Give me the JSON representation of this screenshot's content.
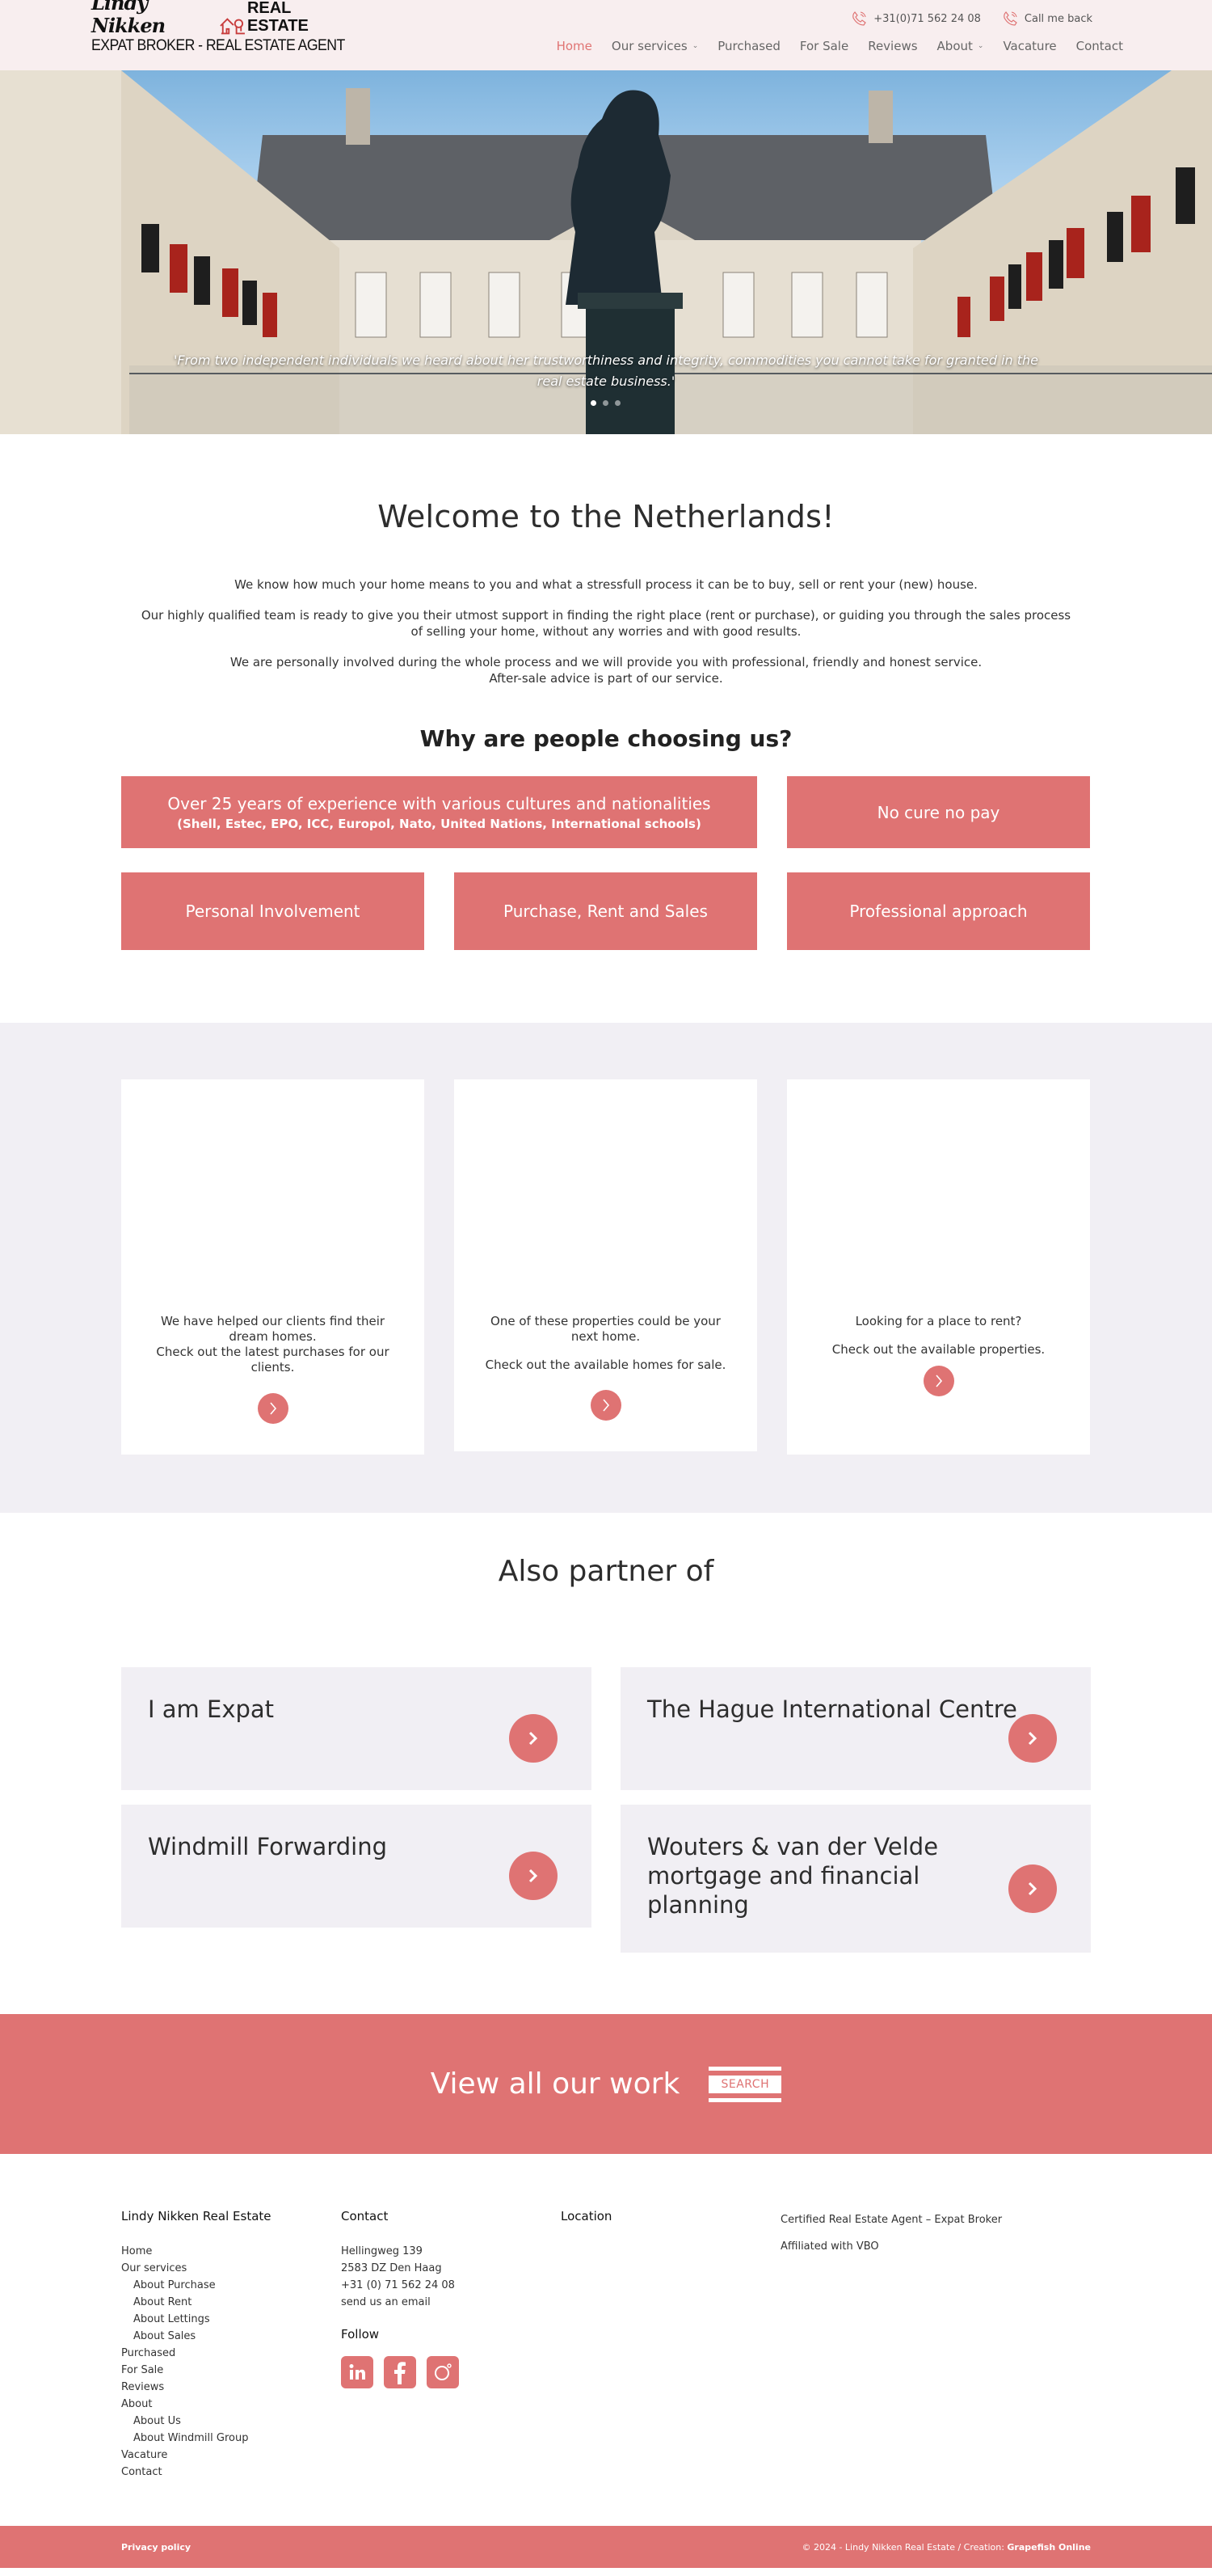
{
  "header": {
    "logo": {
      "script": "Lindy Nikken",
      "wordmark": "REAL ESTATE",
      "tagline": "EXPAT BROKER - REAL ESTATE AGENT"
    },
    "topbar": [
      {
        "icon": "phone-icon",
        "label": "+31(0)71 562 24 08"
      },
      {
        "icon": "phone-icon",
        "label": "Call me back"
      }
    ],
    "nav": [
      {
        "label": "Home",
        "active": true,
        "dropdown": false
      },
      {
        "label": "Our services",
        "active": false,
        "dropdown": true
      },
      {
        "label": "Purchased",
        "active": false,
        "dropdown": false
      },
      {
        "label": "For Sale",
        "active": false,
        "dropdown": false
      },
      {
        "label": "Reviews",
        "active": false,
        "dropdown": false
      },
      {
        "label": "About",
        "active": false,
        "dropdown": true
      },
      {
        "label": "Vacature",
        "active": false,
        "dropdown": false
      },
      {
        "label": "Contact",
        "active": false,
        "dropdown": false
      }
    ]
  },
  "hero": {
    "quote": "'From two independent individuals we heard about her trustworthiness and integrity, commodities you cannot take for granted in the real estate business.'",
    "slides": 3,
    "active_slide": 1
  },
  "welcome": {
    "title": "Welcome to the Netherlands!",
    "paragraphs": [
      "We know how much your home means to you and what a stressfull process it can be to buy, sell or rent your (new) house.",
      "Our highly qualified team is ready to give you their utmost support in finding the right place (rent or purchase), or guiding you through the sales process of selling your home, without any worries and with good results.",
      "We are personally involved during the whole process and we will provide you with professional, friendly and honest service.",
      "After-sale advice is part of our service."
    ]
  },
  "why": {
    "title": "Why are people choosing us?",
    "features": [
      {
        "title": "Over 25 years of experience with various cultures and nationalities",
        "sub": "(Shell, Estec, EPO, ICC, Europol, Nato, United Nations, International schools)"
      },
      {
        "title": "No cure no pay"
      },
      {
        "title": "Personal Involvement"
      },
      {
        "title": "Purchase, Rent and Sales"
      },
      {
        "title": "Professional approach"
      }
    ]
  },
  "cards": [
    {
      "lines": [
        "We have helped our clients find their dream homes.",
        "Check out the latest purchases for our clients."
      ]
    },
    {
      "lines": [
        "One of these properties could be your next home.",
        "Check out the available homes for sale."
      ]
    },
    {
      "lines": [
        "Looking for a place to rent?",
        "Check out the available properties."
      ]
    }
  ],
  "partners": {
    "title": "Also partner of",
    "items": [
      {
        "name": "I am Expat"
      },
      {
        "name": "The Hague International Centre"
      },
      {
        "name": "Windmill Forwarding"
      },
      {
        "name": "Wouters & van der Velde mortgage and financial planning"
      }
    ]
  },
  "cta": {
    "text": "View all our work",
    "button": "SEARCH"
  },
  "footer": {
    "col1": {
      "title": "Lindy Nikken Real Estate",
      "links": [
        {
          "label": "Home",
          "indent": false
        },
        {
          "label": "Our services",
          "indent": false
        },
        {
          "label": "About Purchase",
          "indent": true
        },
        {
          "label": "About Rent",
          "indent": true
        },
        {
          "label": "About Lettings",
          "indent": true
        },
        {
          "label": "About Sales",
          "indent": true
        },
        {
          "label": "Purchased",
          "indent": false
        },
        {
          "label": "For Sale",
          "indent": false
        },
        {
          "label": "Reviews",
          "indent": false
        },
        {
          "label": "About",
          "indent": false
        },
        {
          "label": "About Us",
          "indent": true
        },
        {
          "label": "About Windmill Group",
          "indent": true
        },
        {
          "label": "Vacature",
          "indent": false
        },
        {
          "label": "Contact",
          "indent": false
        }
      ]
    },
    "col2": {
      "title": "Contact",
      "address1": "Hellingweg 139",
      "address2": "2583 DZ Den Haag",
      "phone": "+31 (0) 71 562 24 08",
      "email_link": "send us an email",
      "follow_title": "Follow",
      "socials": [
        "linkedin-icon",
        "facebook-icon",
        "instagram-icon"
      ]
    },
    "col3": {
      "title": "Location"
    },
    "col4": {
      "lines": [
        "Certified Real Estate Agent – Expat Broker",
        "Affiliated with VBO"
      ]
    }
  },
  "bottombar": {
    "privacy": "Privacy policy",
    "copyright": "© 2024 - Lindy Nikken Real Estate / Creation: ",
    "creator": "Grapefish Online"
  },
  "colors": {
    "accent": "#df7373",
    "header_bg": "#f8eeef",
    "section_bg": "#f1eff4",
    "text": "#2d2d2d"
  }
}
